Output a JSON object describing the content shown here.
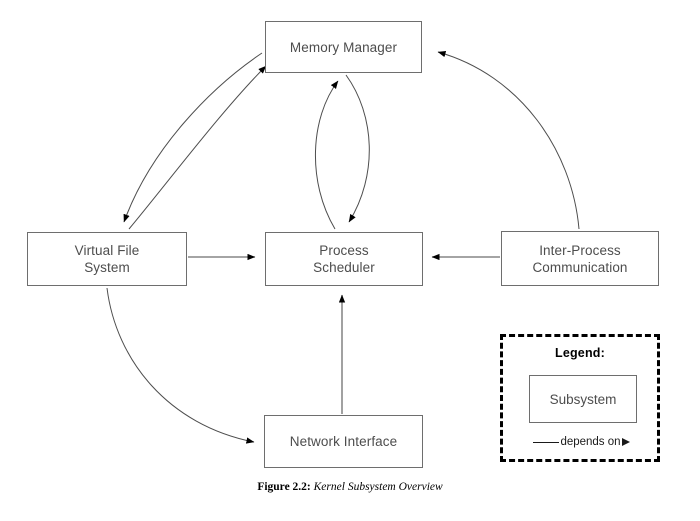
{
  "figure": {
    "caption_label": "Figure 2.2:",
    "caption_title": "Kernel Subsystem Overview"
  },
  "nodes": {
    "memory_manager": "Memory Manager",
    "virtual_file_system": "Virtual File\nSystem",
    "process_scheduler": "Process\nScheduler",
    "inter_process_communication": "Inter-Process\nCommunication",
    "network_interface": "Network Interface"
  },
  "legend": {
    "title": "Legend:",
    "subsystem_label": "Subsystem",
    "edge_label": "depends on"
  },
  "colors": {
    "node_border": "#6e6e6e",
    "node_text": "#4d4d4d",
    "edge": "#4d4d4d",
    "arrowhead": "#000000",
    "legend_border": "#000000",
    "background": "#ffffff"
  },
  "diagram_data": {
    "type": "directed-graph",
    "edge_semantics": "depends on",
    "nodes": [
      {
        "id": "memory_manager",
        "label": "Memory Manager"
      },
      {
        "id": "virtual_file_system",
        "label": "Virtual File System"
      },
      {
        "id": "process_scheduler",
        "label": "Process Scheduler"
      },
      {
        "id": "inter_process_communication",
        "label": "Inter-Process Communication"
      },
      {
        "id": "network_interface",
        "label": "Network Interface"
      }
    ],
    "edges": [
      {
        "from": "memory_manager",
        "to": "virtual_file_system",
        "style": "curved"
      },
      {
        "from": "virtual_file_system",
        "to": "memory_manager",
        "style": "curved"
      },
      {
        "from": "memory_manager",
        "to": "process_scheduler",
        "style": "curved"
      },
      {
        "from": "process_scheduler",
        "to": "memory_manager",
        "style": "curved"
      },
      {
        "from": "inter_process_communication",
        "to": "memory_manager",
        "style": "curved"
      },
      {
        "from": "virtual_file_system",
        "to": "process_scheduler",
        "style": "straight"
      },
      {
        "from": "inter_process_communication",
        "to": "process_scheduler",
        "style": "straight"
      },
      {
        "from": "network_interface",
        "to": "process_scheduler",
        "style": "straight"
      },
      {
        "from": "virtual_file_system",
        "to": "network_interface",
        "style": "curved"
      }
    ]
  }
}
